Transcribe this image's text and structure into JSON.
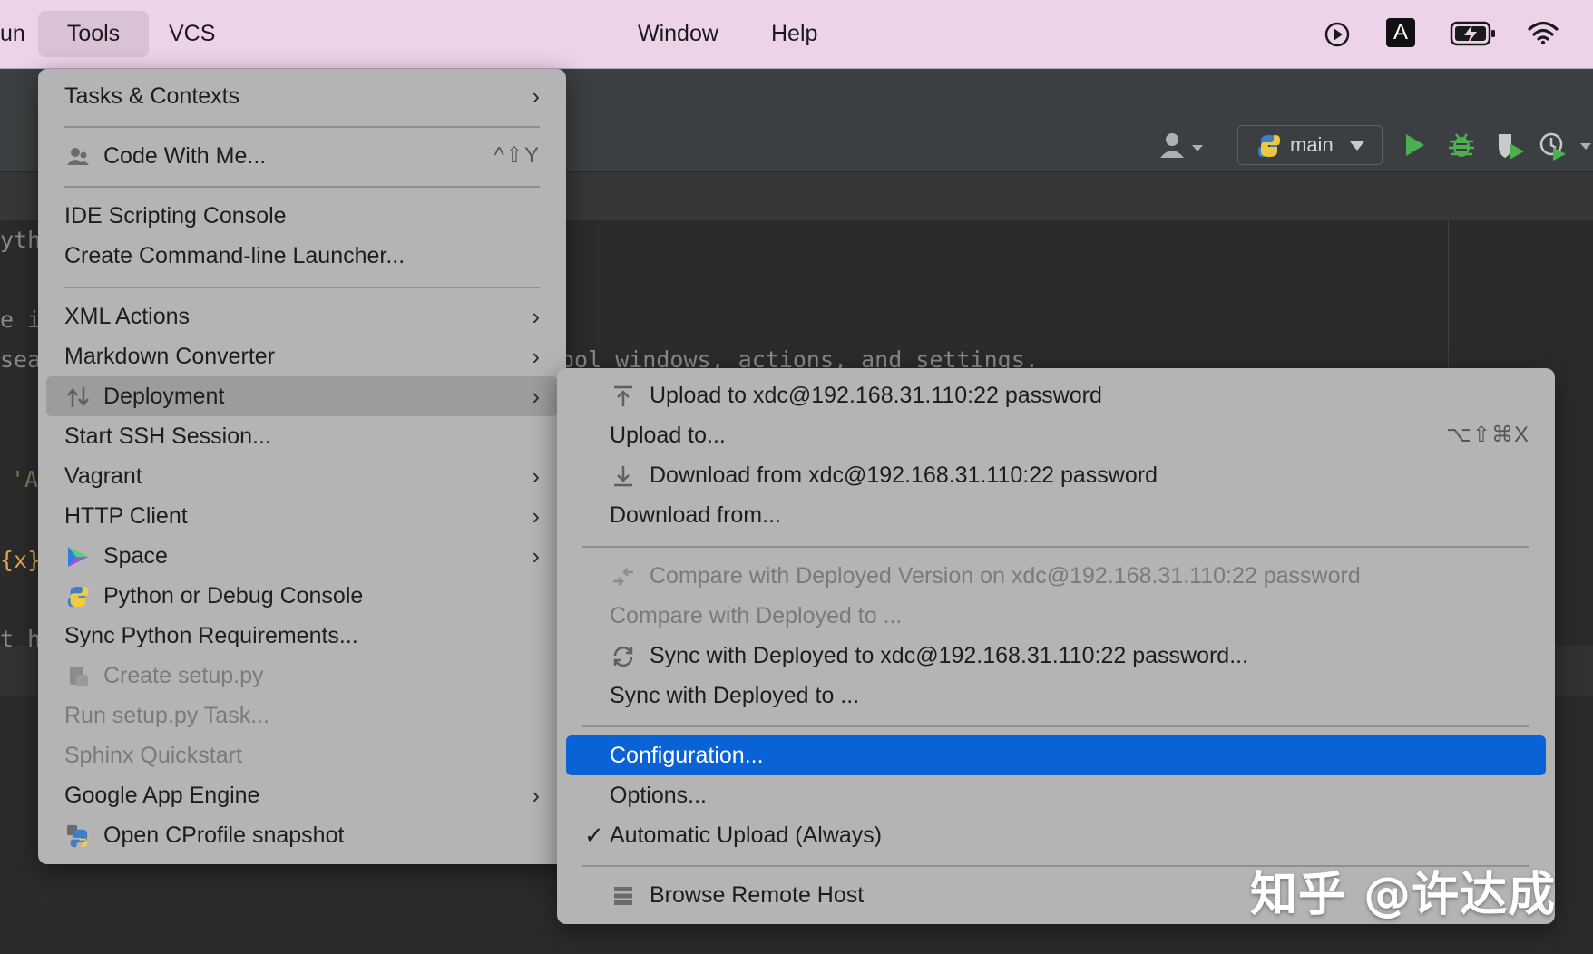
{
  "menubar": {
    "items": [
      "un",
      "Tools",
      "VCS",
      "Window",
      "Help"
    ],
    "status_icon_text": "A"
  },
  "ide": {
    "run_config": "main",
    "code_fragments": [
      "yth",
      "e i",
      "sea",
      "ool windows, actions, and settings.",
      "'A",
      "{x}",
      "t h"
    ]
  },
  "tools_menu": {
    "items": [
      {
        "label": "Tasks & Contexts",
        "submenu": true
      },
      {
        "label": "Code With Me...",
        "shortcut": "^⇧Y",
        "icon": "code-with-me-icon"
      },
      {
        "label": "IDE Scripting Console"
      },
      {
        "label": "Create Command-line Launcher..."
      },
      {
        "label": "XML Actions",
        "submenu": true
      },
      {
        "label": "Markdown Converter",
        "submenu": true
      },
      {
        "label": "Deployment",
        "submenu": true,
        "icon": "deployment-icon",
        "selected": true
      },
      {
        "label": "Start SSH Session..."
      },
      {
        "label": "Vagrant",
        "submenu": true
      },
      {
        "label": "HTTP Client",
        "submenu": true
      },
      {
        "label": "Space",
        "submenu": true,
        "icon": "space-icon"
      },
      {
        "label": "Python or Debug Console",
        "icon": "python-icon"
      },
      {
        "label": "Sync Python Requirements..."
      },
      {
        "label": "Create setup.py",
        "disabled": true,
        "icon": "setup-py-icon"
      },
      {
        "label": "Run setup.py Task...",
        "disabled": true
      },
      {
        "label": "Sphinx Quickstart",
        "disabled": true
      },
      {
        "label": "Google App Engine",
        "submenu": true
      },
      {
        "label": "Open CProfile snapshot",
        "icon": "cprofile-icon"
      }
    ],
    "arrow_glyph": "›"
  },
  "deployment_menu": {
    "items": [
      {
        "label": "Upload to xdc@192.168.31.110:22 password",
        "icon": "upload-icon"
      },
      {
        "label": "Upload to...",
        "shortcut": "⌥⇧⌘X"
      },
      {
        "label": "Download from xdc@192.168.31.110:22 password",
        "icon": "download-icon"
      },
      {
        "label": "Download from..."
      },
      {
        "label": "Compare with Deployed Version on xdc@192.168.31.110:22 password",
        "disabled": true,
        "icon": "compare-icon"
      },
      {
        "label": "Compare with Deployed to ...",
        "disabled": true
      },
      {
        "label": "Sync with Deployed to xdc@192.168.31.110:22 password...",
        "icon": "sync-icon"
      },
      {
        "label": "Sync with Deployed to ..."
      },
      {
        "label": "Configuration...",
        "highlighted": true
      },
      {
        "label": "Options..."
      },
      {
        "label": "Automatic Upload (Always)",
        "checked": true
      },
      {
        "label": "Browse Remote Host",
        "icon": "browse-remote-host-icon"
      }
    ],
    "check_glyph": "✓"
  },
  "watermark": "知乎 @许达成",
  "colors": {
    "menubar_bg": "#ecd3ea",
    "menu_bg": "#b4b4b4",
    "highlight": "#0a63d6",
    "ide_bg": "#2b2b2b",
    "run_green": "#4caf50"
  }
}
